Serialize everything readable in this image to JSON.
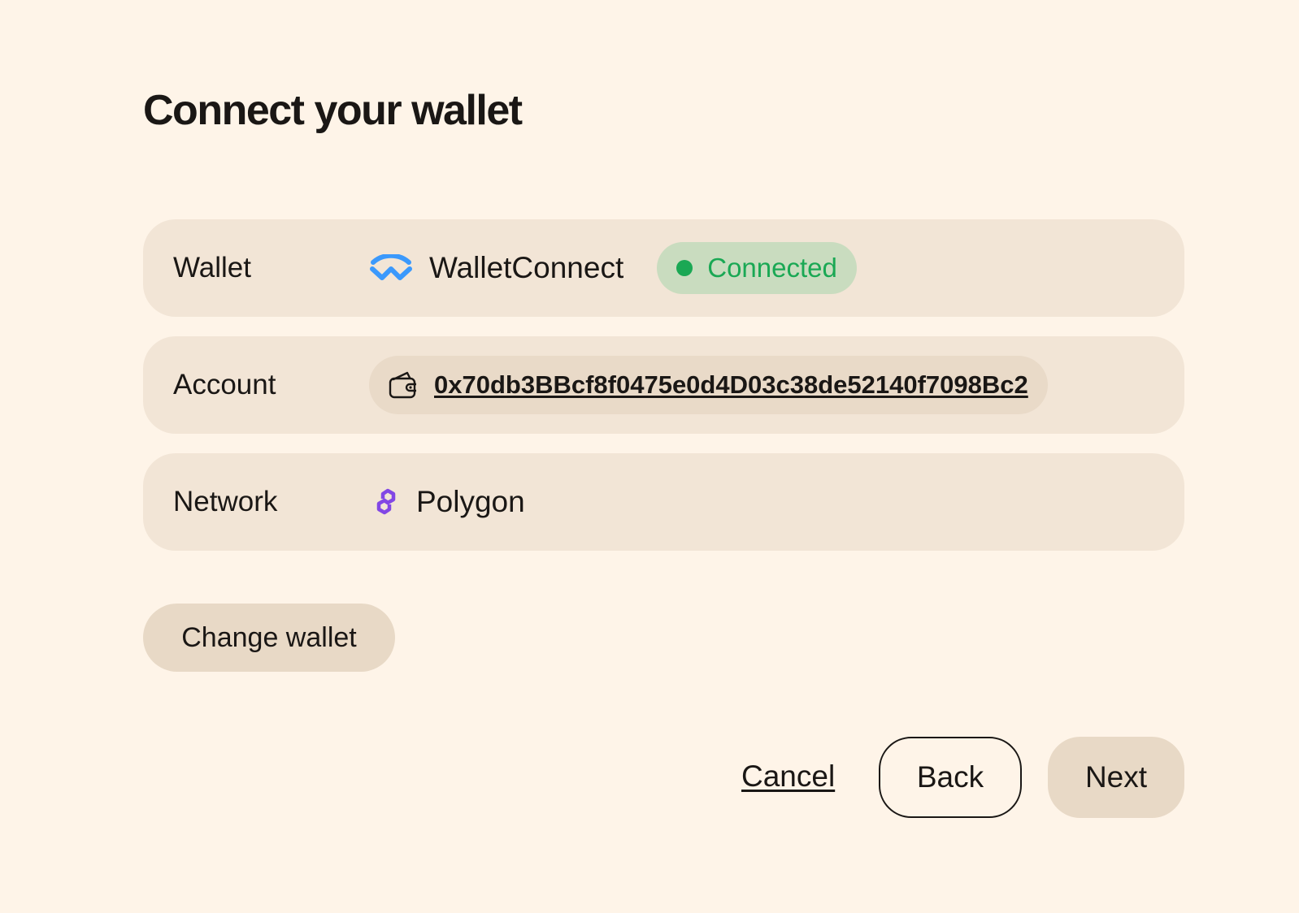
{
  "page": {
    "title": "Connect your wallet"
  },
  "wallet_row": {
    "label": "Wallet",
    "icon": "walletconnect-icon",
    "name": "WalletConnect",
    "status": "Connected"
  },
  "account_row": {
    "label": "Account",
    "icon": "wallet-icon",
    "address": "0x70db3BBcf8f0475e0d4D03c38de52140f7098Bc2"
  },
  "network_row": {
    "label": "Network",
    "icon": "polygon-icon",
    "name": "Polygon"
  },
  "actions": {
    "change_wallet_label": "Change wallet",
    "cancel_label": "Cancel",
    "back_label": "Back",
    "next_label": "Next"
  },
  "colors": {
    "background": "#fef4e8",
    "row_background": "#f2e5d6",
    "button_background": "#e8d9c6",
    "status_green": "#1aa854",
    "status_badge_background": "#c9dcbf",
    "walletconnect_blue": "#3b99fc",
    "polygon_purple": "#8247e5"
  }
}
